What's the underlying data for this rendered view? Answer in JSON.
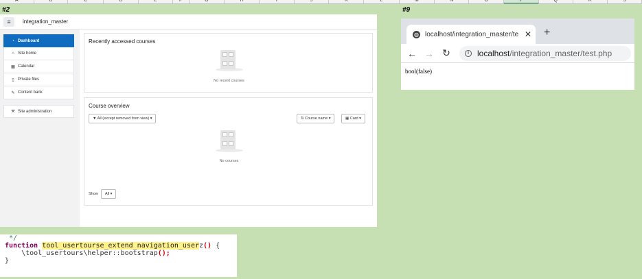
{
  "spreadsheet": {
    "columns": [
      "A",
      "B",
      "C",
      "D",
      "E",
      "F",
      "G",
      "H",
      "I",
      "J",
      "K",
      "L",
      "M",
      "N",
      "O",
      "P",
      "Q",
      "R",
      "S"
    ],
    "selected_column": "P",
    "label_left": "#2",
    "label_right": "#9"
  },
  "moodle": {
    "site_name": "integration_master",
    "sidebar": [
      {
        "label": "Dashboard",
        "icon": "dashboard-icon",
        "glyph": "◔",
        "active": true
      },
      {
        "label": "Site home",
        "icon": "home-icon",
        "glyph": "⌂"
      },
      {
        "label": "Calendar",
        "icon": "calendar-icon",
        "glyph": "▦"
      },
      {
        "label": "Private files",
        "icon": "file-icon",
        "glyph": "▯"
      },
      {
        "label": "Content bank",
        "icon": "pencil-icon",
        "glyph": "✎"
      },
      {
        "label": "Site administration",
        "icon": "wrench-icon",
        "glyph": "⚒"
      }
    ],
    "recent": {
      "title": "Recently accessed courses",
      "empty_text": "No recent courses"
    },
    "overview": {
      "title": "Course overview",
      "filter_label": "All (except removed from view)",
      "sort_label": "Course name",
      "view_label": "Card",
      "empty_text": "No courses",
      "show_label": "Show",
      "show_value": "All"
    }
  },
  "browser": {
    "tab_title": "localhost/integration_master/te",
    "url_host": "localhost",
    "url_path": "/integration_master/test.php",
    "content": "bool(false)"
  },
  "code": {
    "comment": " */",
    "keyword": "function",
    "fn_name_highlighted": "tool_usertourse_extend_navigation_user",
    "fn_name_tail": "z",
    "open_paren_close": "()",
    "brace": " {",
    "body_prefix": "    \\tool_usertours\\helper::bootstrap",
    "body_call": "();",
    "close": "}"
  }
}
